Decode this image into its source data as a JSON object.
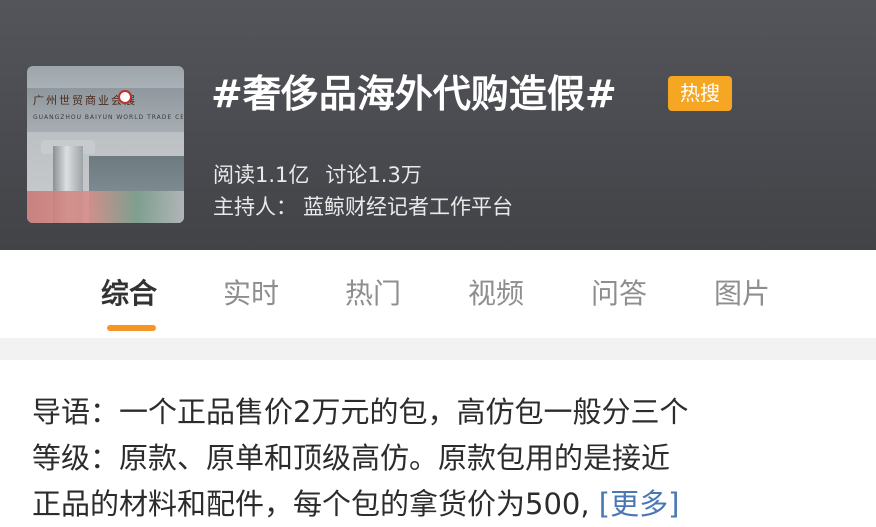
{
  "topic": {
    "title": "#奢侈品海外代购造假#",
    "badge": "热搜",
    "reads": "阅读1.1亿",
    "discussions": "讨论1.3万",
    "host_label": "主持人：",
    "host_name": "蓝鲸财经记者工作平台",
    "cover_image": "building-facade-photo"
  },
  "tabs": [
    {
      "label": "综合",
      "active": true
    },
    {
      "label": "实时",
      "active": false
    },
    {
      "label": "热门",
      "active": false
    },
    {
      "label": "视频",
      "active": false
    },
    {
      "label": "问答",
      "active": false
    },
    {
      "label": "图片",
      "active": false
    }
  ],
  "intro": {
    "lines": [
      "导语：一个正品售价2万元的包，高仿包一般分三个",
      "等级：原款、原单和顶级高仿。原款包用的是接近",
      "正品的材料和配件，每个包的拿货价为500"
    ],
    "more_label": "[更多]"
  },
  "colors": {
    "header_bg": "#4d4e53",
    "badge": "#f5a623",
    "tab_indicator": "#f59523",
    "link": "#4a78b5"
  }
}
